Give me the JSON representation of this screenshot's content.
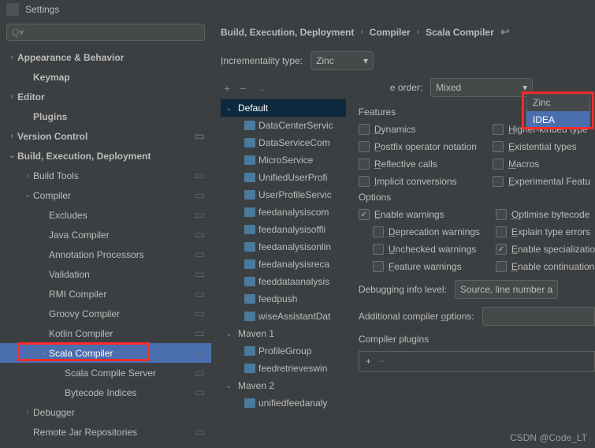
{
  "titlebar": {
    "title": "Settings"
  },
  "search": {
    "placeholder": "Q▾"
  },
  "sidebar": {
    "items": [
      {
        "label": "Appearance & Behavior",
        "level": 0,
        "bold": true,
        "exp": "›"
      },
      {
        "label": "Keymap",
        "level": 1,
        "bold": true
      },
      {
        "label": "Editor",
        "level": 0,
        "bold": true,
        "exp": "›"
      },
      {
        "label": "Plugins",
        "level": 1,
        "bold": true
      },
      {
        "label": "Version Control",
        "level": 0,
        "bold": true,
        "exp": "›",
        "rail": true
      },
      {
        "label": "Build, Execution, Deployment",
        "level": 0,
        "bold": true,
        "exp": "⌄"
      },
      {
        "label": "Build Tools",
        "level": 1,
        "exp": "›",
        "rail": true
      },
      {
        "label": "Compiler",
        "level": 1,
        "exp": "⌄",
        "rail": true
      },
      {
        "label": "Excludes",
        "level": 2,
        "rail": true
      },
      {
        "label": "Java Compiler",
        "level": 2,
        "rail": true
      },
      {
        "label": "Annotation Processors",
        "level": 2,
        "rail": true
      },
      {
        "label": "Validation",
        "level": 2,
        "rail": true
      },
      {
        "label": "RMI Compiler",
        "level": 2,
        "rail": true
      },
      {
        "label": "Groovy Compiler",
        "level": 2,
        "rail": true
      },
      {
        "label": "Kotlin Compiler",
        "level": 2,
        "rail": true
      },
      {
        "label": "Scala Compiler",
        "level": 2,
        "exp": "⌄",
        "rail": true,
        "selected": true
      },
      {
        "label": "Scala Compile Server",
        "level": 3,
        "rail": true
      },
      {
        "label": "Bytecode Indices",
        "level": 3,
        "rail": true
      },
      {
        "label": "Debugger",
        "level": 1,
        "exp": "›"
      },
      {
        "label": "Remote Jar Repositories",
        "level": 1,
        "rail": true
      }
    ]
  },
  "breadcrumb": [
    "Build, Execution, Deployment",
    "Compiler",
    "Scala Compiler"
  ],
  "incrementality": {
    "label": "Incrementality type:",
    "value": "Zinc",
    "options": [
      "Zinc",
      "IDEA"
    ]
  },
  "module_tree": {
    "groups": [
      {
        "name": "Default",
        "selected": true,
        "children": [
          "DataCenterServic",
          "DataServiceCom",
          "MicroService",
          "UnifiedUserProfi",
          "UserProfileServic",
          "feedanalysiscom",
          "feedanalysisoffli",
          "feedanalysisonlin",
          "feedanalysisreca",
          "feeddataanalysis",
          "feedpush",
          "wiseAssistantDat"
        ]
      },
      {
        "name": "Maven 1",
        "children": [
          "ProfileGroup",
          "feedretrieveswin"
        ]
      },
      {
        "name": "Maven 2",
        "children": [
          "unifiedfeedanaly"
        ]
      }
    ]
  },
  "compile_order": {
    "label": "e order:",
    "value": "Mixed"
  },
  "features": {
    "title": "Features",
    "left": [
      "Dynamics",
      "Postfix operator notation",
      "Reflective calls",
      "Implicit conversions"
    ],
    "right": [
      "Higher-kinded type",
      "Existential types",
      "Macros",
      "Experimental Featu"
    ]
  },
  "options": {
    "title": "Options",
    "enable_warnings": "Enable warnings",
    "sub": [
      "Deprecation warnings",
      "Unchecked warnings",
      "Feature warnings"
    ],
    "right": [
      "Optimise bytecode",
      "Explain type errors",
      "Enable specializatio",
      "Enable continuation"
    ],
    "right_checked_index": 2
  },
  "debugging": {
    "label": "Debugging info level:",
    "value": "Source, line number a"
  },
  "additional": {
    "label": "Additional compiler options:"
  },
  "plugins": {
    "title": "Compiler plugins"
  },
  "watermark": "CSDN @Code_LT"
}
